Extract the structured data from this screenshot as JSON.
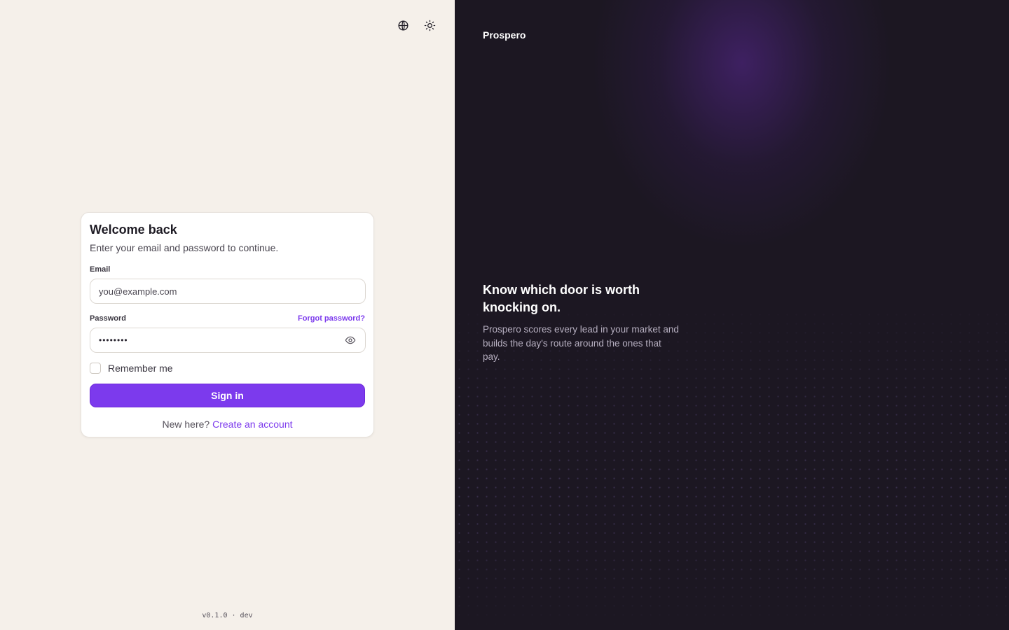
{
  "topbar": {
    "language_icon": "globe-icon",
    "theme_icon": "sun-icon"
  },
  "login": {
    "title": "Welcome back",
    "subtitle": "Enter your email and password to continue.",
    "email_label": "Email",
    "email_placeholder": "you@example.com",
    "password_label": "Password",
    "forgot_label": "Forgot password?",
    "password_mask": "••••••••",
    "show_password_icon": "eye-icon",
    "remember_label": "Remember me",
    "remember_checked": false,
    "signin_label": "Sign in",
    "new_here": "New here?",
    "create_account": "Create an account"
  },
  "footer": {
    "version": "v0.1.0 · dev"
  },
  "brand_panel": {
    "brand": "Prospero",
    "headline": "Know which door is worth knocking on.",
    "description": "Prospero scores every lead in your market and builds the day's route around the ones that pay."
  },
  "colors": {
    "accent": "#7c3aed",
    "left_bg": "#f5f0ea",
    "right_bg": "#1c1722"
  }
}
